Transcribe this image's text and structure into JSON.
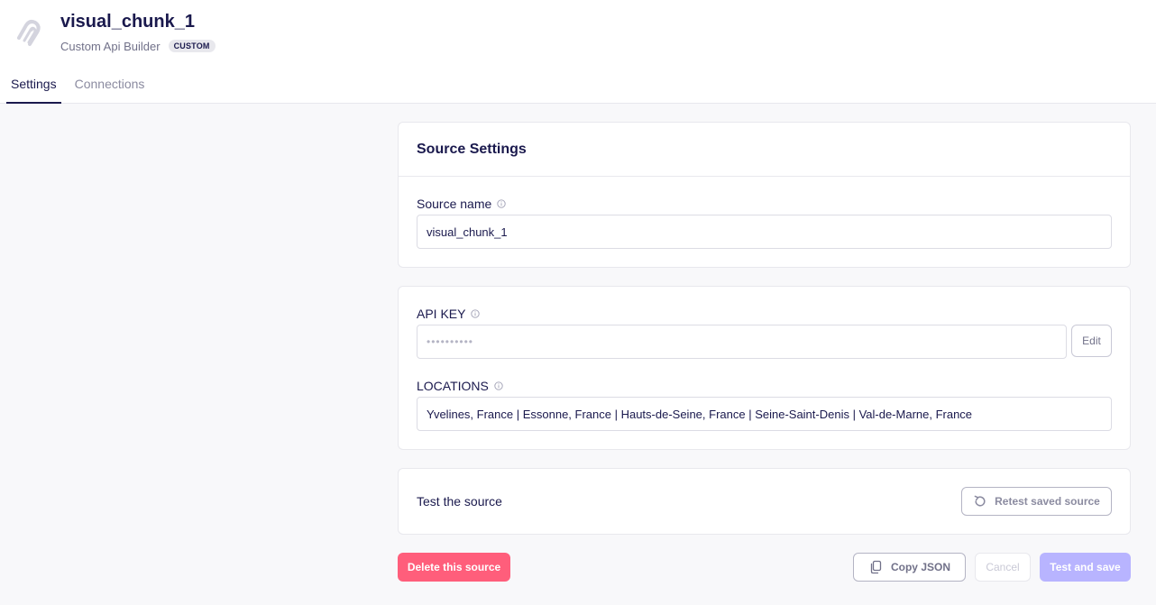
{
  "header": {
    "title": "visual_chunk_1",
    "subtitle": "Custom Api Builder",
    "badge": "CUSTOM",
    "logo_icon": "airbyte-logo-icon"
  },
  "tabs": [
    {
      "label": "Settings",
      "active": true
    },
    {
      "label": "Connections",
      "active": false
    }
  ],
  "source_settings": {
    "heading": "Source Settings",
    "source_name_label": "Source name",
    "source_name_value": "visual_chunk_1"
  },
  "credentials": {
    "api_key_label": "API KEY",
    "api_key_masked": "••••••••••",
    "edit_label": "Edit",
    "locations_label": "LOCATIONS",
    "locations_value": "Yvelines, France | Essonne, France | Hauts-de-Seine, France | Seine-Saint-Denis | Val-de-Marne, France"
  },
  "test": {
    "label": "Test the source",
    "retest_label": "Retest saved source"
  },
  "actions": {
    "delete_label": "Delete this source",
    "copy_json_label": "Copy JSON",
    "cancel_label": "Cancel",
    "save_label": "Test and save"
  },
  "colors": {
    "primary_text": "#1a194d",
    "danger": "#ff5e7b",
    "save_disabled": "#b8b4ff",
    "background": "#f8f8fa"
  }
}
